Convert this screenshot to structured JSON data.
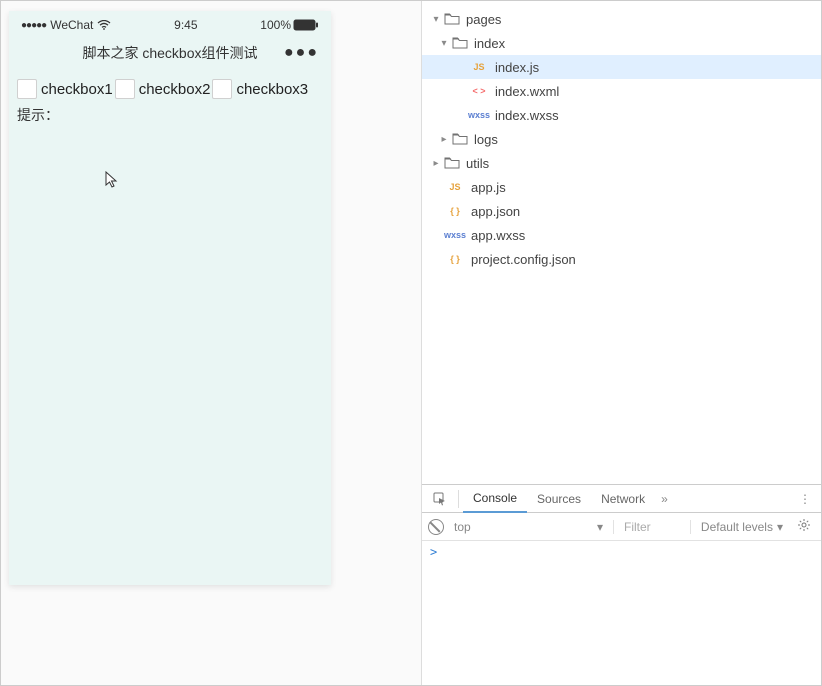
{
  "statusbar": {
    "carrier": "WeChat",
    "signal_dots": "●●●●●",
    "time": "9:45",
    "battery_pct": "100%"
  },
  "navbar": {
    "title": "脚本之家 checkbox组件测试",
    "menu": "●●●"
  },
  "page": {
    "checkboxes": [
      "checkbox1",
      "checkbox2",
      "checkbox3"
    ],
    "hint_label": "提示："
  },
  "tree": {
    "items": [
      {
        "type": "folder",
        "name": "pages",
        "open": true,
        "indent": 0
      },
      {
        "type": "folder",
        "name": "index",
        "open": true,
        "indent": 1
      },
      {
        "type": "file",
        "name": "index.js",
        "badge": "JS",
        "badgeClass": "badge-js",
        "indent": 2,
        "selected": true
      },
      {
        "type": "file",
        "name": "index.wxml",
        "badge": "< >",
        "badgeClass": "badge-wxml",
        "indent": 2
      },
      {
        "type": "file",
        "name": "index.wxss",
        "badge": "wxss",
        "badgeClass": "badge-wxss",
        "indent": 2
      },
      {
        "type": "folder",
        "name": "logs",
        "open": false,
        "indent": 1
      },
      {
        "type": "folder",
        "name": "utils",
        "open": false,
        "indent": 0
      },
      {
        "type": "file",
        "name": "app.js",
        "badge": "JS",
        "badgeClass": "badge-js",
        "indent": 0
      },
      {
        "type": "file",
        "name": "app.json",
        "badge": "{ }",
        "badgeClass": "badge-json",
        "indent": 0
      },
      {
        "type": "file",
        "name": "app.wxss",
        "badge": "wxss",
        "badgeClass": "badge-wxss",
        "indent": 0
      },
      {
        "type": "file",
        "name": "project.config.json",
        "badge": "{ }",
        "badgeClass": "badge-json",
        "indent": 0
      }
    ]
  },
  "devtools": {
    "tabs": {
      "console": "Console",
      "sources": "Sources",
      "network": "Network"
    },
    "more": "»",
    "menu": "⋮",
    "filterbar": {
      "context": "top",
      "context_arrow": "▾",
      "filter_placeholder": "Filter",
      "levels": "Default levels",
      "levels_arrow": "▾"
    },
    "console_prompt": ">"
  }
}
